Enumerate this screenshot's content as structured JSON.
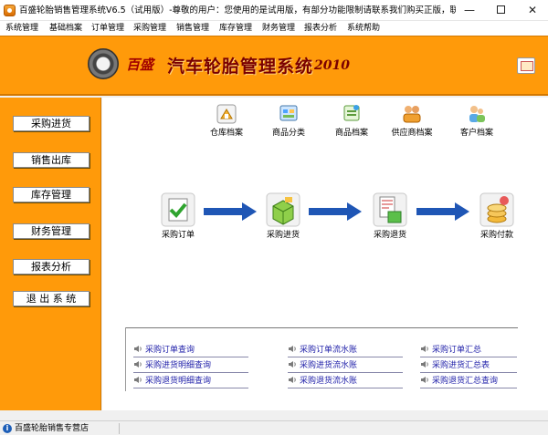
{
  "window": {
    "title": "百盛轮胎销售管理系统V6.5（试用版）-尊敬的用户：您使用的是试用版，有部分功能限制请联系我们购买正版，联系...",
    "minimize_glyph": "—",
    "close_glyph": "✕"
  },
  "menu": {
    "items": [
      {
        "label": "系统管理"
      },
      {
        "label": "基础档案"
      },
      {
        "label": "订单管理"
      },
      {
        "label": "采购管理"
      },
      {
        "label": "销售管理"
      },
      {
        "label": "库存管理"
      },
      {
        "label": "财务管理"
      },
      {
        "label": "报表分析"
      },
      {
        "label": "系统帮助"
      }
    ]
  },
  "banner": {
    "brand": "百盛",
    "title": "汽车轮胎管理系统",
    "year": "2010"
  },
  "sidebar": {
    "items": [
      {
        "label": "采购进货"
      },
      {
        "label": "销售出库"
      },
      {
        "label": "库存管理"
      },
      {
        "label": "财务管理"
      },
      {
        "label": "报表分析"
      },
      {
        "label": "退 出 系 统"
      }
    ]
  },
  "archives": {
    "items": [
      {
        "label": "仓库档案",
        "icon": "warehouse-icon"
      },
      {
        "label": "商品分类",
        "icon": "category-icon"
      },
      {
        "label": "商品档案",
        "icon": "product-icon"
      },
      {
        "label": "供应商档案",
        "icon": "supplier-icon"
      },
      {
        "label": "客户档案",
        "icon": "customer-icon"
      }
    ]
  },
  "flow": {
    "items": [
      {
        "label": "采购订单",
        "icon": "purchase-order-icon"
      },
      {
        "label": "采购进货",
        "icon": "purchase-receive-icon"
      },
      {
        "label": "采购退货",
        "icon": "purchase-return-icon"
      },
      {
        "label": "采购付款",
        "icon": "purchase-payment-icon"
      }
    ]
  },
  "reports": {
    "col1": [
      "采购订单查询",
      "采购进货明细查询",
      "采购退货明细查询"
    ],
    "col2": [
      "采购订单流水账",
      "采购进货流水账",
      "采购退货流水账"
    ],
    "col3": [
      "采购订单汇总",
      "采购进货汇总表",
      "采购退货汇总查询"
    ]
  },
  "status": {
    "text": "百盛轮胎销售专营店"
  },
  "colors": {
    "accent": "#ff9a0a",
    "link": "#2222aa",
    "arrow": "#1f56b5"
  }
}
